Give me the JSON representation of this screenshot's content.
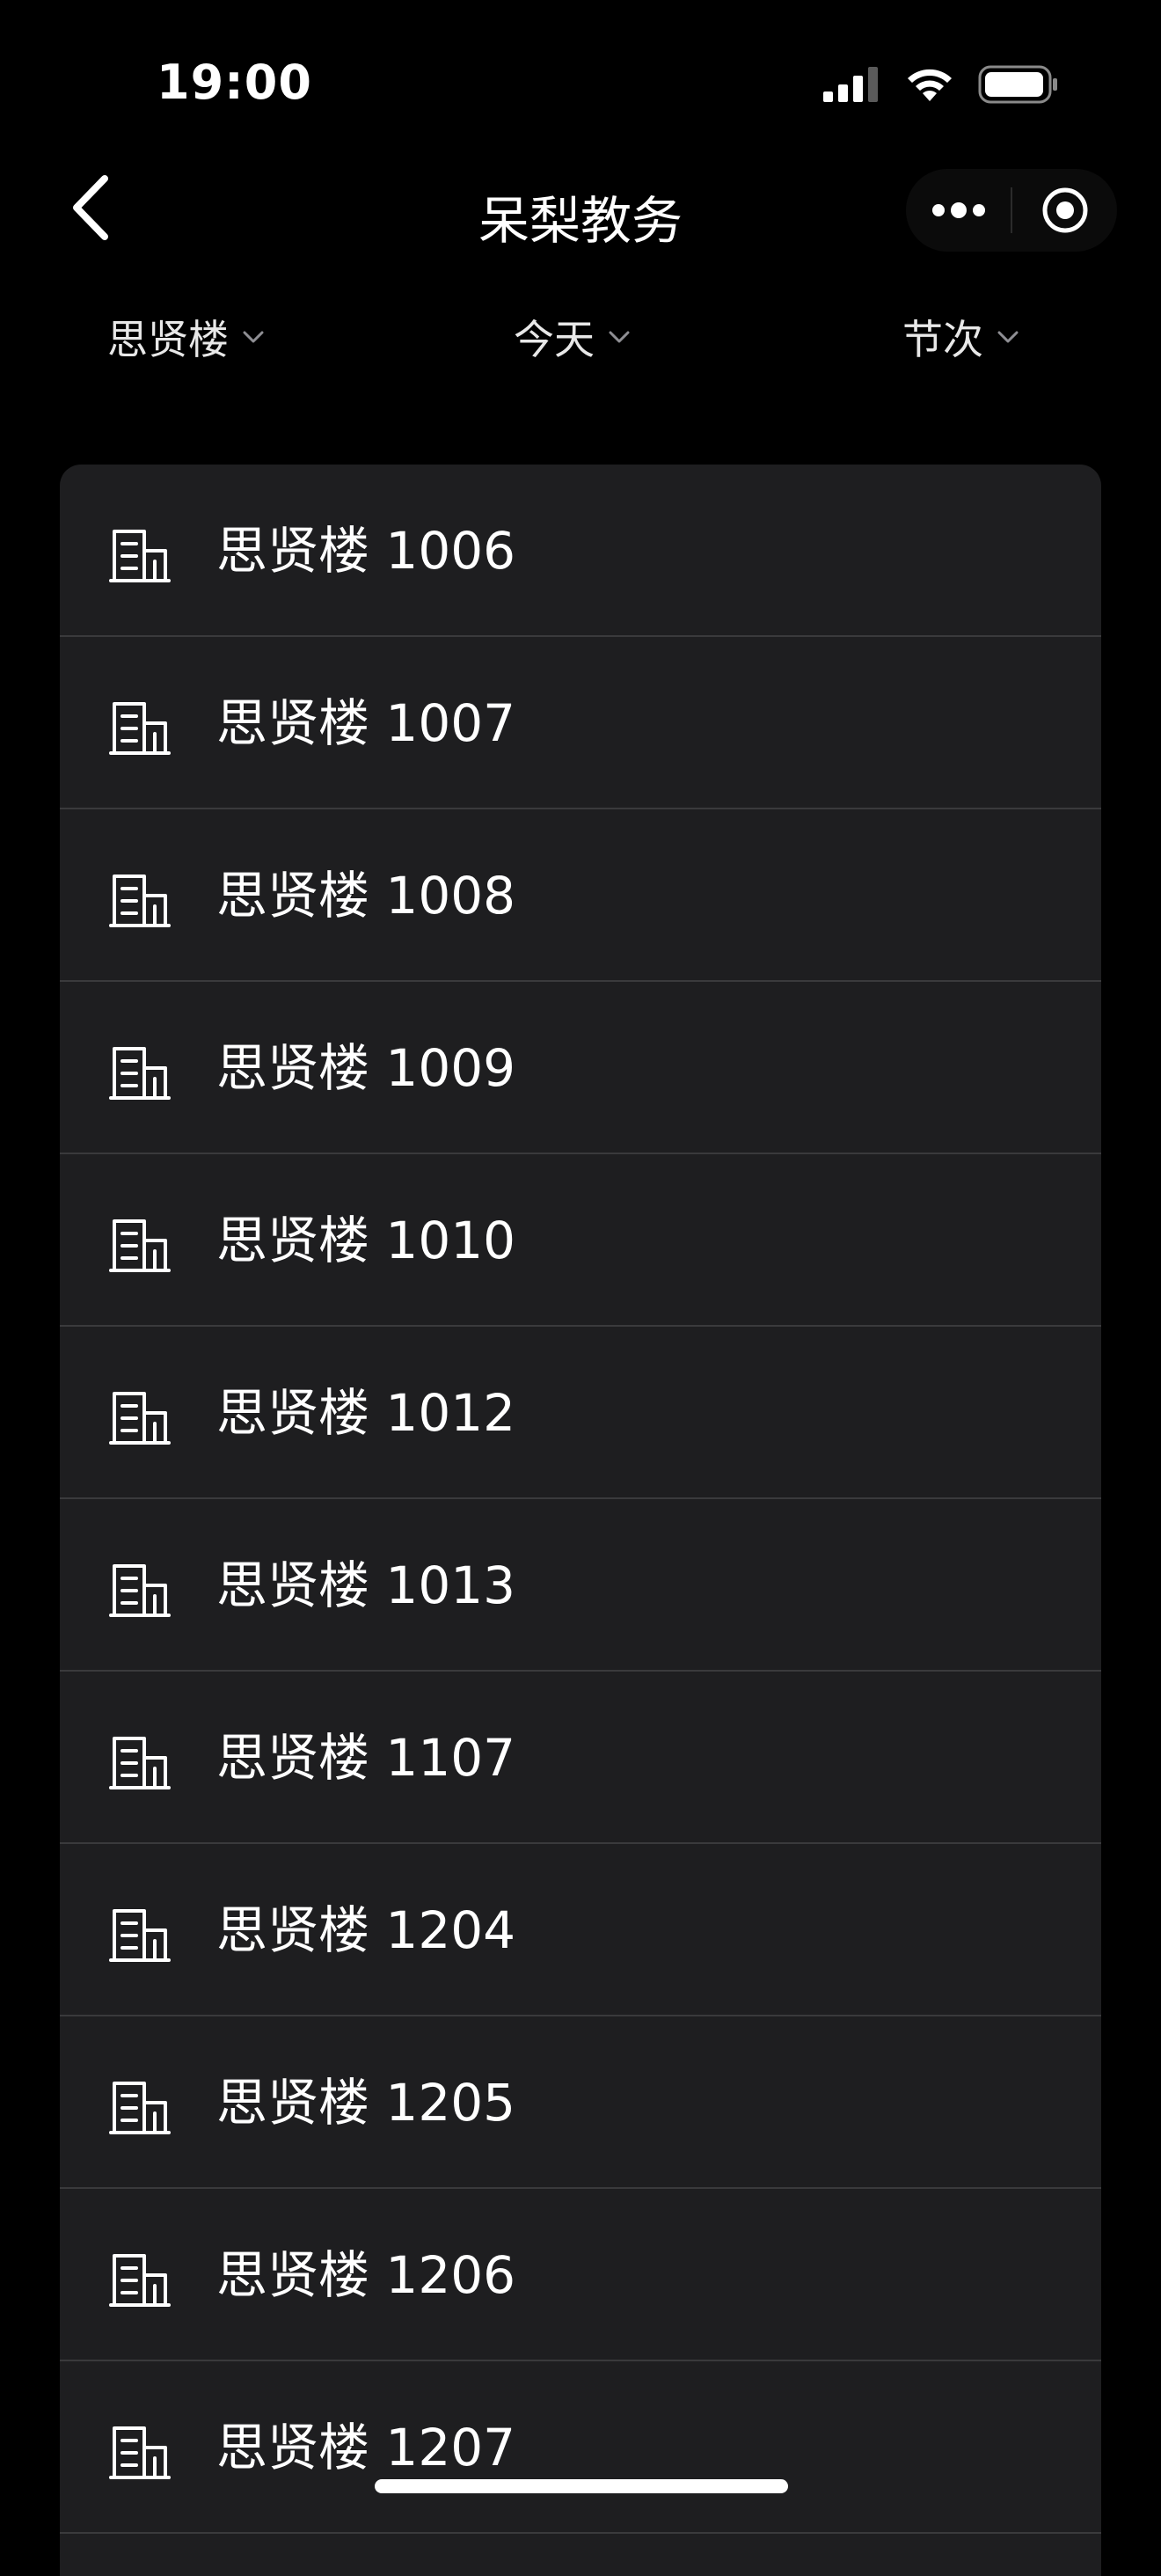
{
  "status_bar": {
    "time": "19:00",
    "signal_icon": "cellular-signal-icon",
    "wifi_icon": "wifi-icon",
    "battery_icon": "battery-icon"
  },
  "nav": {
    "title": "呆梨教务",
    "back_icon": "chevron-left-icon",
    "more_icon": "more-dots-icon",
    "close_icon": "target-circle-icon"
  },
  "filters": [
    {
      "label": "思贤楼",
      "icon": "chevron-down-icon"
    },
    {
      "label": "今天",
      "icon": "chevron-down-icon"
    },
    {
      "label": "节次",
      "icon": "chevron-down-icon"
    }
  ],
  "rooms": [
    {
      "label": "思贤楼 1006",
      "icon": "building-icon"
    },
    {
      "label": "思贤楼 1007",
      "icon": "building-icon"
    },
    {
      "label": "思贤楼 1008",
      "icon": "building-icon"
    },
    {
      "label": "思贤楼 1009",
      "icon": "building-icon"
    },
    {
      "label": "思贤楼 1010",
      "icon": "building-icon"
    },
    {
      "label": "思贤楼 1012",
      "icon": "building-icon"
    },
    {
      "label": "思贤楼 1013",
      "icon": "building-icon"
    },
    {
      "label": "思贤楼 1107",
      "icon": "building-icon"
    },
    {
      "label": "思贤楼 1204",
      "icon": "building-icon"
    },
    {
      "label": "思贤楼 1205",
      "icon": "building-icon"
    },
    {
      "label": "思贤楼 1206",
      "icon": "building-icon"
    },
    {
      "label": "思贤楼 1207",
      "icon": "building-icon"
    }
  ],
  "colors": {
    "background": "#000000",
    "card": "#1e1e20",
    "divider": "#3a3a3c",
    "text": "#ffffff"
  }
}
